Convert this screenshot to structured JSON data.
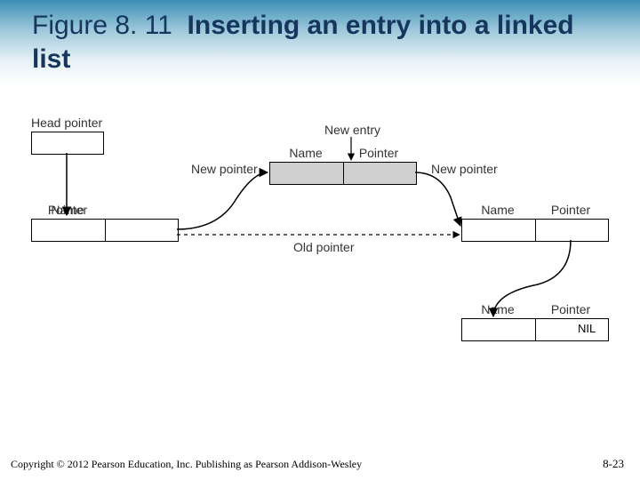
{
  "title": {
    "figure_number": "Figure 8. 11",
    "figure_text": "Inserting an entry into a linked list"
  },
  "diagram": {
    "labels": {
      "head_pointer": "Head pointer",
      "new_entry": "New entry",
      "new_pointer_left": "New pointer",
      "new_pointer_right": "New pointer",
      "old_pointer": "Old pointer"
    },
    "cell_headers": {
      "name": "Name",
      "pointer": "Pointer",
      "nil": "NIL"
    }
  },
  "footer": {
    "copyright": "Copyright © 2012 Pearson Education, Inc. Publishing as Pearson Addison-Wesley",
    "page": "8-23"
  }
}
